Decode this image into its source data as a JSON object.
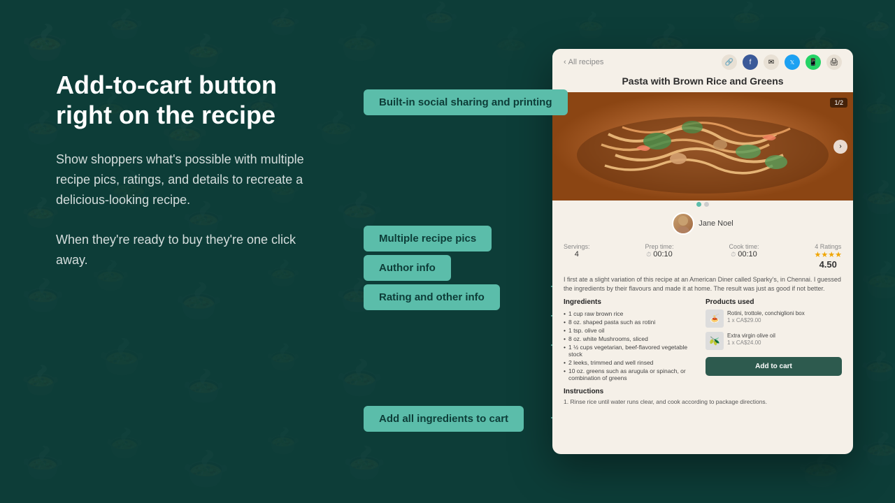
{
  "page": {
    "bg_color": "#0d3d38"
  },
  "left": {
    "heading": "Add-to-cart button right on the recipe",
    "desc1": "Show shoppers what's possible with multiple recipe pics, ratings, and details to recreate a delicious-looking recipe.",
    "desc2": "When they're ready to buy they're one click away."
  },
  "features": {
    "social": "Built-in social sharing and printing",
    "pics": "Multiple recipe pics",
    "author": "Author info",
    "rating": "Rating and other info",
    "cart": "Add all ingredients to cart"
  },
  "recipe": {
    "back_label": "All recipes",
    "title": "Pasta with Brown Rice and Greens",
    "image_counter": "1/2",
    "author_name": "Jane Noel",
    "ratings_count": "4 Ratings",
    "rating_value": "4.50",
    "stars": "★★★★",
    "servings_label": "Servings:",
    "servings_value": "4",
    "prep_label": "Prep time:",
    "prep_value": "00:10",
    "cook_label": "Cook time:",
    "cook_value": "00:10",
    "description": "I first ate a slight variation of this recipe at an American Diner called Sparky's, in Chennai. I guessed the ingredients by their flavours and made it at home. The result was just as good if not better.",
    "ingredients_title": "Ingredients",
    "ingredients": [
      "1 cup raw brown rice",
      "8 oz. shaped pasta such as rotini",
      "1 tsp. olive oil",
      "8 oz. white Mushrooms, sliced",
      "1 ½ cups vegetarian, beef-flavored vegetable stock",
      "2 leeks, trimmed and well rinsed",
      "10 oz. greens such as arugula or spinach, or combination of greens"
    ],
    "products_title": "Products used",
    "products": [
      {
        "name": "Rotini, trottole, conchiglioni box",
        "qty": "1 x CA$29.00",
        "emoji": "🍝"
      },
      {
        "name": "Extra virgin olive oil",
        "qty": "1 x CA$24.00",
        "emoji": "🫒"
      }
    ],
    "add_to_cart_label": "Add to cart",
    "instructions_title": "Instructions",
    "instructions_text": "1. Rinse rice until water runs clear, and cook according to package directions."
  }
}
